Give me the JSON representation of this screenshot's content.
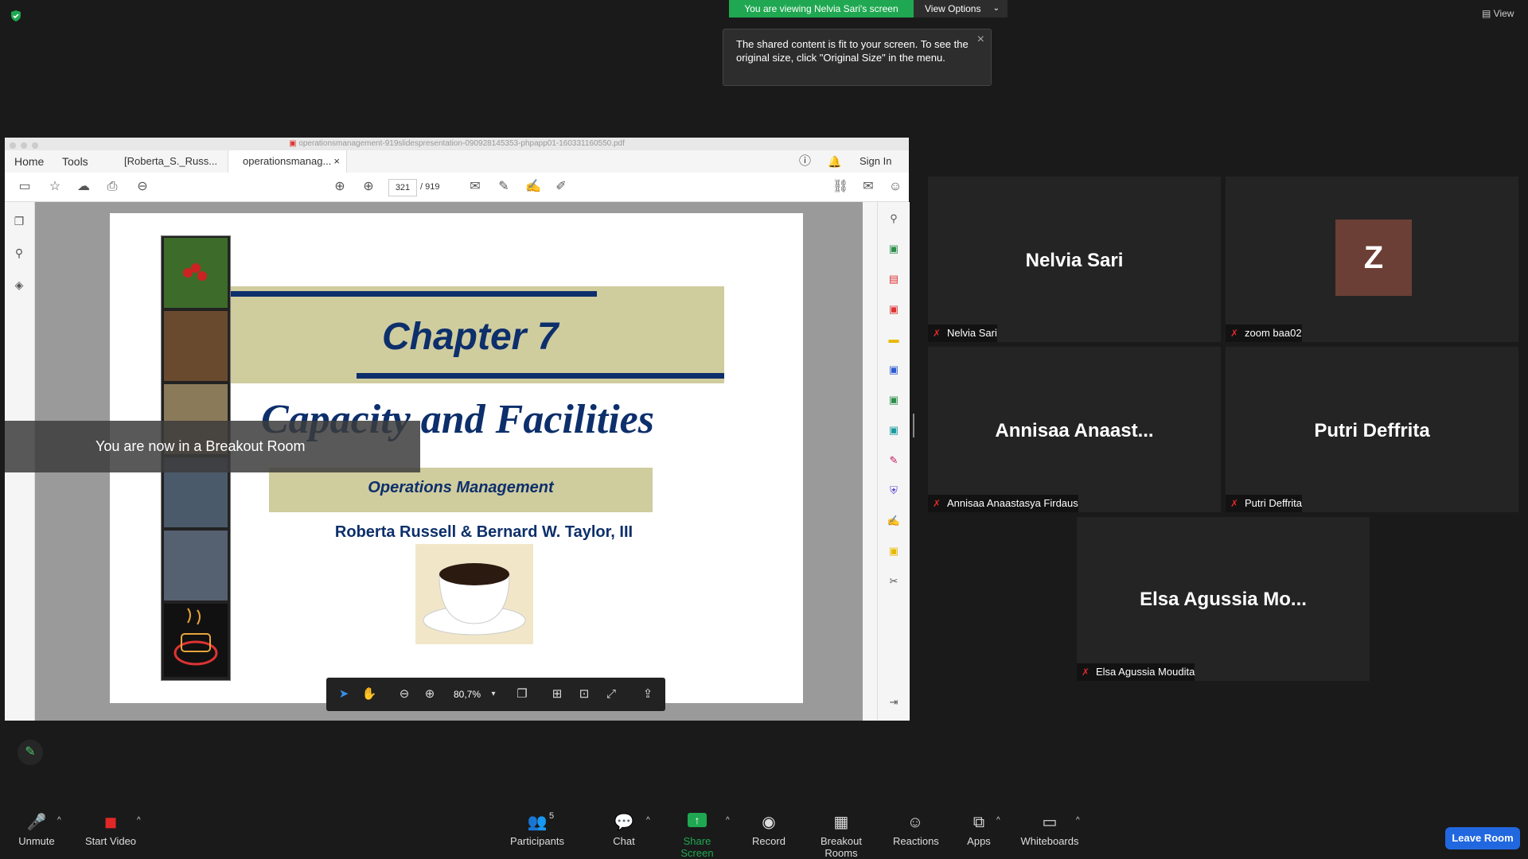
{
  "banner": {
    "viewing": "You are viewing Nelvia Sari's screen",
    "view_options": "View Options",
    "tooltip": "The shared content is fit to your screen. To see the original size, click \"Original Size\" in the menu.",
    "view": "View"
  },
  "acrobat": {
    "file_title": "operationsmanagement-919slidespresentation-090928145353-phpapp01-160331160550.pdf",
    "tabs": [
      "Home",
      "Tools",
      "[Roberta_S._Russ...",
      "operationsmanag..."
    ],
    "sign_in": "Sign In",
    "page_current": "321",
    "page_total": "/ 919",
    "zoom": "80,7%"
  },
  "slide": {
    "chapter": "Chapter 7",
    "title": "Capacity and Facilities",
    "subtitle": "Operations Management",
    "authors": "Roberta Russell & Bernard W. Taylor, III"
  },
  "breakout_notice": "You are now in a Breakout Room",
  "participants": [
    {
      "display": "Nelvia Sari",
      "label": "Nelvia Sari"
    },
    {
      "display": "Z",
      "label": "zoom baa02"
    },
    {
      "display": "Annisaa  Anaast...",
      "label": "Annisaa Anaastasya Firdaus"
    },
    {
      "display": "Putri Deffrita",
      "label": "Putri Deffrita"
    },
    {
      "display": "Elsa  Agussia  Mo...",
      "label": "Elsa Agussia Moudita"
    }
  ],
  "bottom": {
    "unmute": "Unmute",
    "start_video": "Start Video",
    "participants": "Participants",
    "participants_count": "5",
    "chat": "Chat",
    "share_screen": "Share Screen",
    "record": "Record",
    "breakout_rooms": "Breakout Rooms",
    "reactions": "Reactions",
    "apps": "Apps",
    "whiteboards": "Whiteboards",
    "leave_room": "Leave Room"
  },
  "colors": {
    "accent_green": "#1fa851",
    "leave_blue": "#2168e0",
    "navy": "#0d2f6b",
    "khaki": "#cfcc9e"
  }
}
